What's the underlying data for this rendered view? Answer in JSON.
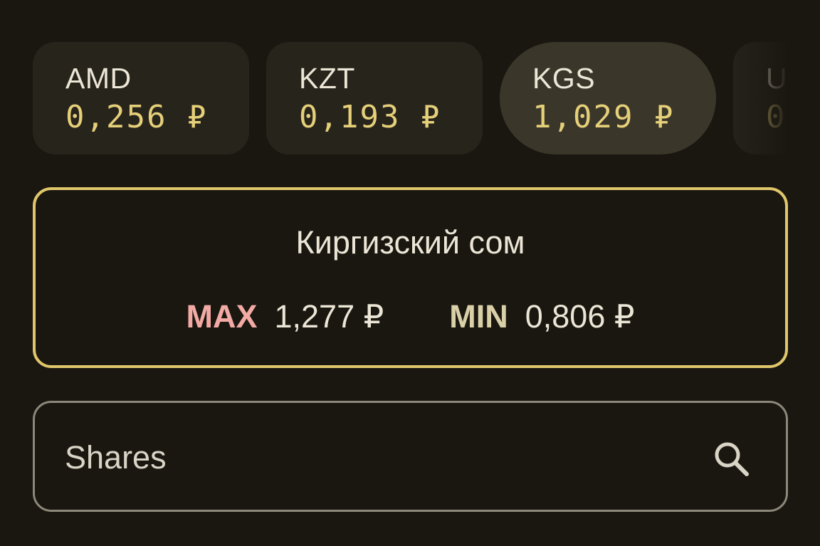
{
  "rates": [
    {
      "code": "AMD",
      "value": "0,256 ₽",
      "selected": false
    },
    {
      "code": "KZT",
      "value": "0,193 ₽",
      "selected": false
    },
    {
      "code": "KGS",
      "value": "1,029 ₽",
      "selected": true
    },
    {
      "code": "U",
      "value": "0",
      "selected": false
    }
  ],
  "detail": {
    "title": "Киргизский сом",
    "max_label": "MAX",
    "max_value": "1,277 ₽",
    "min_label": "MIN",
    "min_value": "0,806 ₽"
  },
  "search": {
    "placeholder": "Shares",
    "icon": "search-icon"
  },
  "colors": {
    "background": "#1a1711",
    "card": "#27241c",
    "card_selected": "#3a372a",
    "accent_gold": "#e0c66b",
    "rate_value": "#e5cf79",
    "max_color": "#f4aaa4",
    "min_color": "#d9d0a8"
  }
}
